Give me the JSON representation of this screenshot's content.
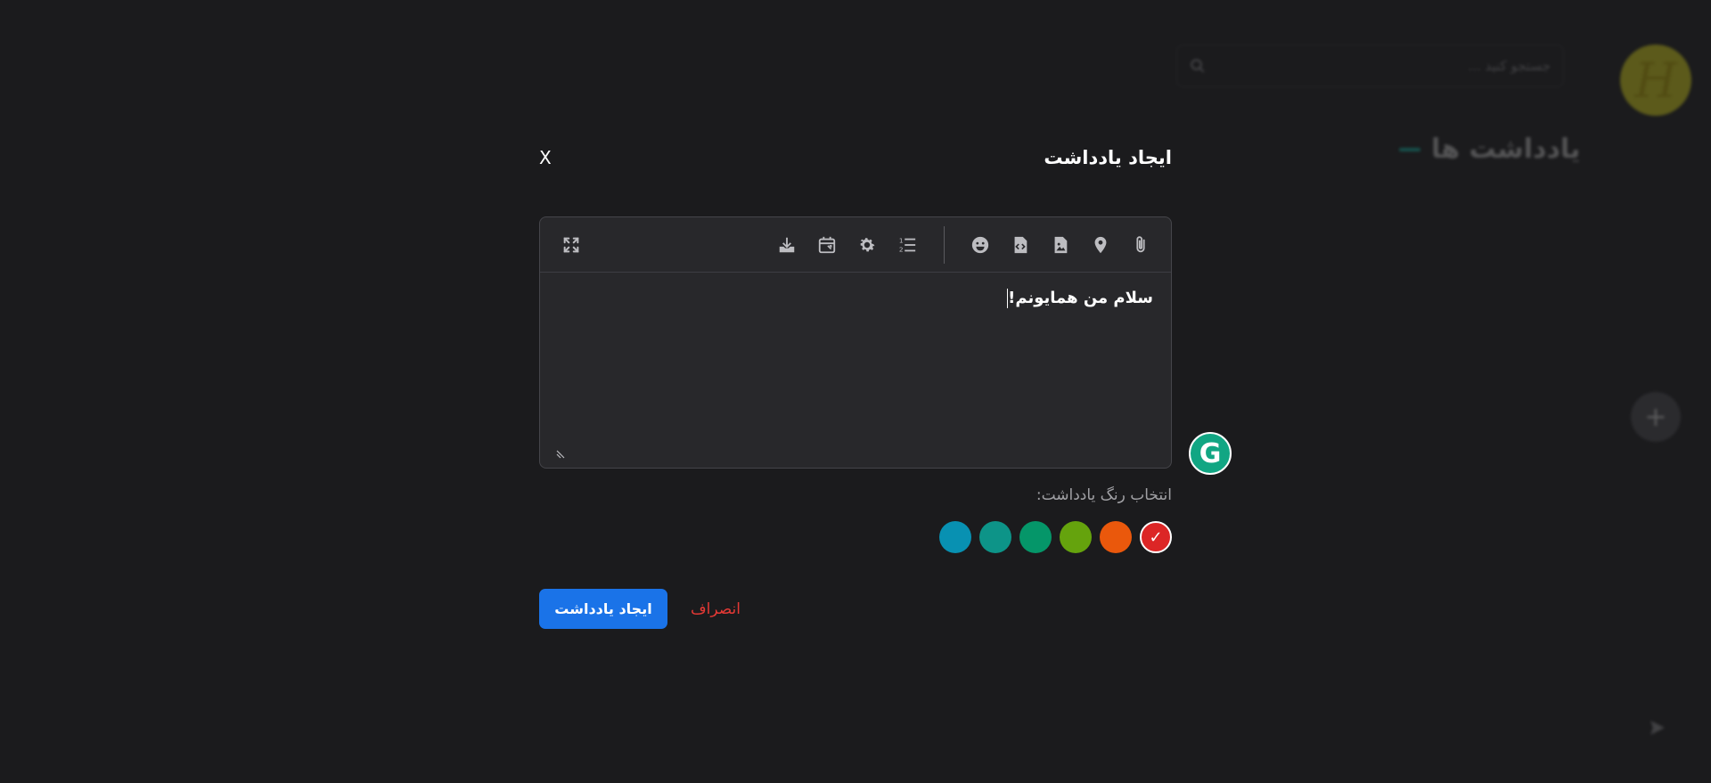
{
  "background": {
    "search_placeholder": "جستجو کنید ...",
    "page_title": "یادداشت ها",
    "avatar_letter": "H",
    "fab_label": "+"
  },
  "modal": {
    "title": "ایجاد یادداشت",
    "close_label": "X",
    "editor": {
      "content": "سلام من همایونم!",
      "toolbar_icons": [
        "attachment-icon",
        "location-icon",
        "image-file-icon",
        "code-file-icon",
        "emoji-icon",
        "ordered-list-icon",
        "settings-icon",
        "calendar-icon",
        "download-icon",
        "fullscreen-icon"
      ]
    },
    "color_label": "انتخاب رنگ یادداشت:",
    "colors": [
      {
        "name": "red",
        "hex": "#dc2626",
        "selected": true,
        "check": "✓"
      },
      {
        "name": "orange",
        "hex": "#ea580c",
        "selected": false
      },
      {
        "name": "lime",
        "hex": "#65a30d",
        "selected": false
      },
      {
        "name": "emerald",
        "hex": "#059669",
        "selected": false
      },
      {
        "name": "teal",
        "hex": "#0d9488",
        "selected": false
      },
      {
        "name": "cyan",
        "hex": "#0891b2",
        "selected": false
      }
    ],
    "create_label": "ایجاد یادداشت",
    "cancel_label": "انصراف"
  },
  "grammarly_label": "G",
  "accent_colors": {
    "primary": "#1a73e8",
    "danger": "#e53935",
    "grammarly": "#11a683"
  }
}
